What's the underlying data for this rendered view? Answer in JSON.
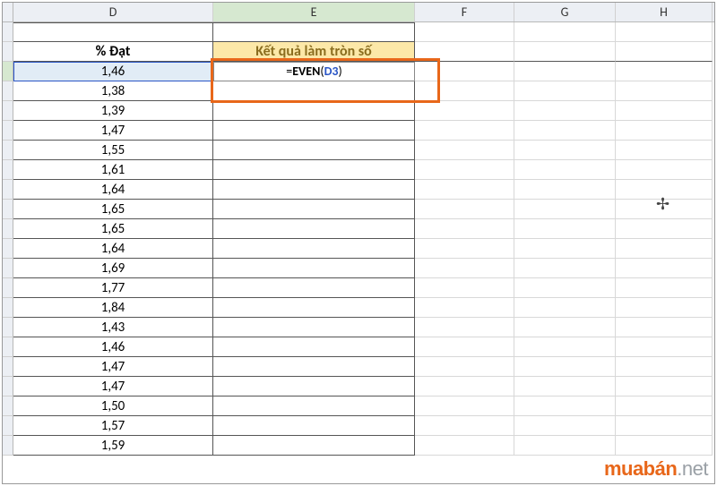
{
  "columns": {
    "D": "D",
    "E": "E",
    "F": "F",
    "G": "G",
    "H": "H"
  },
  "headers": {
    "D": "% Đạt",
    "E": "Kết quả làm tròn số"
  },
  "formula": {
    "prefix": "=",
    "fn": "EVEN",
    "open": "(",
    "ref": "D3",
    "close": ")"
  },
  "values_D": [
    "1,46",
    "1,38",
    "1,39",
    "1,47",
    "1,55",
    "1,61",
    "1,64",
    "1,65",
    "1,65",
    "1,64",
    "1,69",
    "1,77",
    "1,84",
    "1,43",
    "1,46",
    "1,47",
    "1,47",
    "1,50",
    "1,57",
    "1,59"
  ],
  "watermark": {
    "brand": "muabán",
    "suffix": ".net"
  }
}
